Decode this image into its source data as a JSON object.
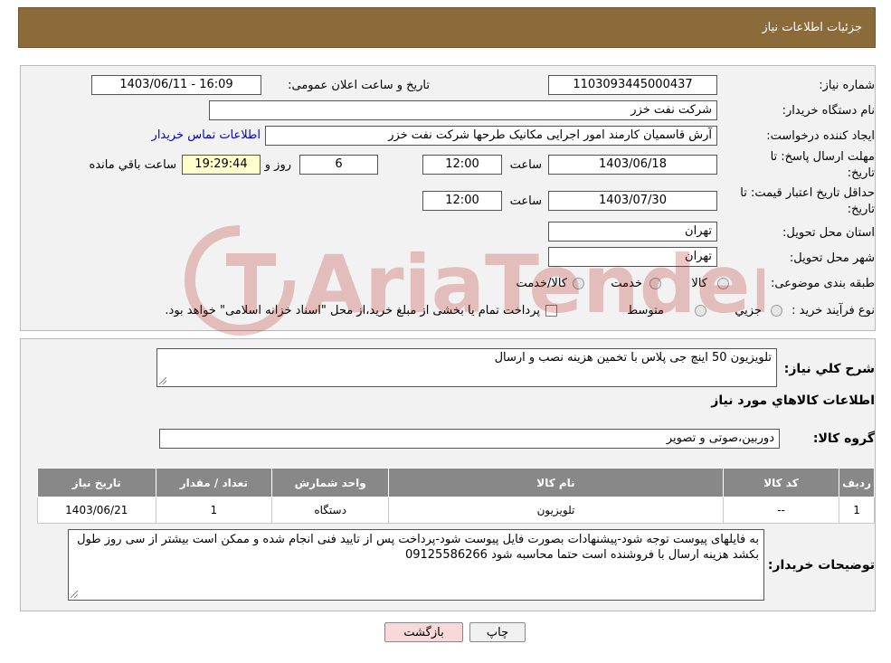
{
  "header": {
    "title": "جزئیات اطلاعات نیاز"
  },
  "form": {
    "need_number_label": "شماره نیاز:",
    "need_number": "1103093445000437",
    "announce_label": "تاریخ و ساعت اعلان عمومی:",
    "announce_value": "1403/06/11 - 16:09",
    "buyer_org_label": "نام دستگاه خریدار:",
    "buyer_org": "شرکت نفت خزر",
    "creator_label": "ایجاد کننده درخواست:",
    "creator": "آرش قاسمیان کارمند امور اجرایی مکانیک طرحها شرکت نفت خزر",
    "contact_link": "اطلاعات تماس خریدار",
    "deadline_label": "مهلت ارسال پاسخ: تا",
    "deadline_label2": "تاریخ:",
    "deadline_date": "1403/06/18",
    "time_label": "ساعت",
    "deadline_time": "12:00",
    "days_value": "6",
    "days_label": "روز و",
    "remaining_time": "19:29:44",
    "remaining_label": "ساعت باقي مانده",
    "validity_label": "حداقل تاریخ اعتبار قیمت: تا",
    "validity_label2": "تاریخ:",
    "validity_date": "1403/07/30",
    "validity_time": "12:00",
    "province_label": "استان محل تحویل:",
    "province": "تهران",
    "city_label": "شهر محل تحویل:",
    "city": "تهران",
    "category_label": "طبقه بندی موضوعی:",
    "category_options": [
      "کالا",
      "خدمت",
      "کالا/خدمت"
    ],
    "process_label": "نوع فرآیند خرید :",
    "process_options": [
      "جزیي",
      "متوسط"
    ],
    "payment_note": "پرداخت تمام یا بخشی از مبلغ خرید،از محل \"اسناد خزانه اسلامی\" خواهد بود."
  },
  "details": {
    "summary_label": "شرح کلي نياز:",
    "summary": "تلویزیون 50 اینچ جی پلاس با تخمین هزینه نصب و ارسال",
    "goods_info_title": "اطلاعات کالاهاي مورد نياز",
    "group_label": "گروه کالا:",
    "group_value": "دوربین،صوتی و تصویر"
  },
  "table": {
    "headers": [
      "رديف",
      "کد کالا",
      "نام کالا",
      "واحد شمارش",
      "تعداد / مقدار",
      "تاریخ نیاز"
    ],
    "rows": [
      [
        "1",
        "--",
        "تلویزیون",
        "دستگاه",
        "1",
        "1403/06/21"
      ]
    ]
  },
  "buyer_notes": {
    "label": "توضیحات خریدار:",
    "text": "به فایلهای پیوست توجه شود-پیشنهادات بصورت فایل پیوست شود-پرداخت پس از تایید فنی انجام شده و ممکن است بیشتر از سی روز طول بکشد هزینه ارسال با فروشنده است حتما محاسبه شود 09125586266"
  },
  "buttons": {
    "print": "چاپ",
    "back": "بازگشت"
  },
  "watermark": {
    "text": "AriaTender.neT"
  },
  "colors": {
    "header_bg": "#8c6b3b",
    "table_header": "#888888",
    "back_btn": "#f7d9d9"
  }
}
